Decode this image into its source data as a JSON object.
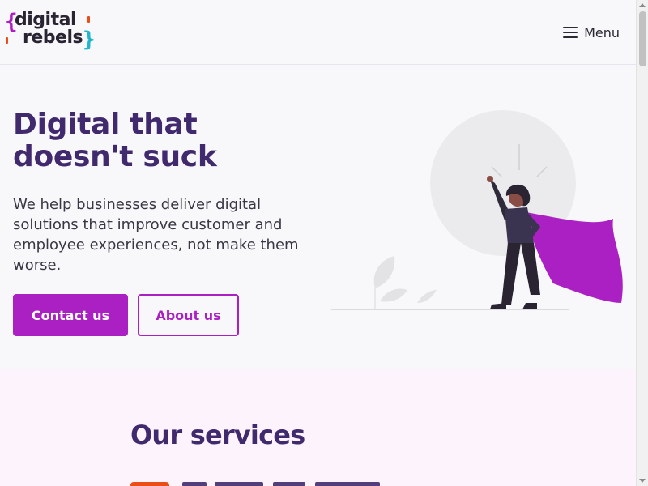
{
  "header": {
    "logo": {
      "line1": "digital",
      "line2": "rebels",
      "open_brace": "{",
      "close_brace": "}"
    },
    "menu_label": "Menu",
    "menu_icon": "hamburger-icon"
  },
  "hero": {
    "title": "Digital that doesn't suck",
    "text": "We help businesses deliver digital solutions that improve customer and employee experiences, not make them worse.",
    "primary_button": "Contact us",
    "secondary_button": "About us",
    "illustration": "superhero-woman-with-cape-illustration"
  },
  "services": {
    "title": "Our services"
  },
  "colors": {
    "brand_purple": "#40296d",
    "accent_magenta": "#ab20c3",
    "brace_cyan": "#21b6c9",
    "service_orange": "#ea4e17",
    "services_background": "#fcf3fd"
  }
}
